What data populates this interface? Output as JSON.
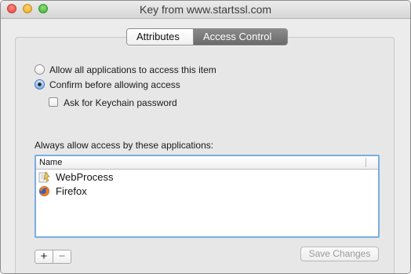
{
  "window": {
    "title": "Key from www.startssl.com"
  },
  "tabs": [
    {
      "label": "Attributes",
      "active": false
    },
    {
      "label": "Access Control",
      "active": true
    }
  ],
  "access": {
    "allow_all_label": "Allow all applications to access this item",
    "allow_all_selected": false,
    "confirm_label": "Confirm before allowing access",
    "confirm_selected": true,
    "keychain_password_label": "Ask for Keychain password",
    "keychain_password_checked": false
  },
  "apps": {
    "section_label": "Always allow access by these applications:",
    "column_header": "Name",
    "items": [
      {
        "name": "WebProcess",
        "icon": "webprocess-icon"
      },
      {
        "name": "Firefox",
        "icon": "firefox-icon"
      }
    ]
  },
  "toolbar": {
    "add_label": "+",
    "remove_label": "−",
    "save_label": "Save Changes",
    "save_enabled": false
  },
  "colors": {
    "selection_border": "#7aaee2",
    "active_tab": "#747474",
    "window_bg": "#ececec"
  }
}
